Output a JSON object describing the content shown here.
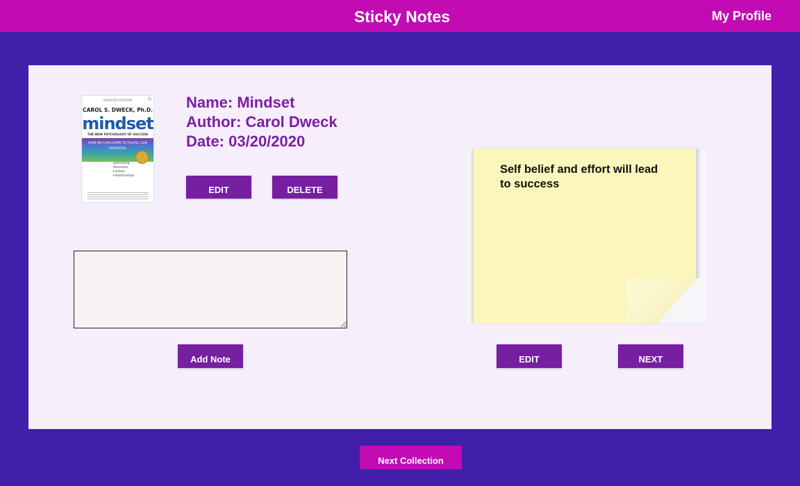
{
  "header": {
    "title": "Sticky Notes",
    "profile_label": "My Profile"
  },
  "book": {
    "name_line": "Name: Mindset",
    "author_line": "Author: Carol Dweck",
    "date_line": "Date: 03/20/2020",
    "edit_label": "EDIT",
    "delete_label": "DELETE",
    "cover": {
      "edition": "UPDATED EDITION",
      "author": "CAROL S. DWECK, Ph.D.",
      "title": "mindset",
      "subtitle": "THE NEW PSYCHOLOGY OF SUCCESS",
      "band_text": "HOW WE CAN LEARN TO FULFILL OUR POTENTIAL",
      "list": [
        "•parenting",
        "•business",
        "•school",
        "•relationships"
      ]
    }
  },
  "note_editor": {
    "value": "",
    "add_label": "Add Note"
  },
  "sticky_note": {
    "text": "Self belief and effort will lead to success",
    "edit_label": "EDIT",
    "next_label": "NEXT"
  },
  "footer": {
    "next_collection_label": "Next Collection"
  },
  "colors": {
    "background": "#421fa8",
    "topbar": "#c20bb3",
    "panel": "#f6eefb",
    "accent_purple": "#761fa1",
    "book_text": "#7b1fa2",
    "sticky_yellow": "#fbf6bc"
  }
}
